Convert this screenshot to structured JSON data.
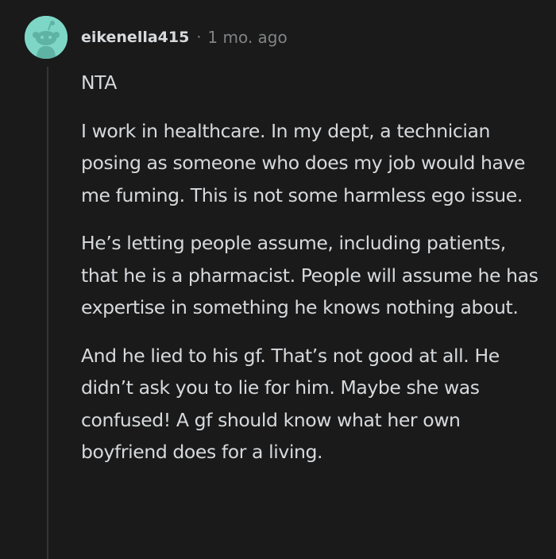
{
  "comment": {
    "username": "eikenella415",
    "separator": "·",
    "timestamp": "1 mo. ago",
    "paragraphs": [
      "NTA",
      "I work in healthcare. In my dept, a technician posing as someone who does my job would have me fuming. This is not some harmless ego issue.",
      "He’s letting people assume, including patients, that he is a pharmacist. People will assume he has expertise in something he knows nothing about.",
      "And he lied to his gf. That’s not good at all. He didn’t ask you to lie for him. Maybe she was confused! A gf should know what her own boyfriend does for a living."
    ],
    "avatar_icon": "snoo-avatar-icon",
    "avatar_color": "#7ed6c6"
  }
}
